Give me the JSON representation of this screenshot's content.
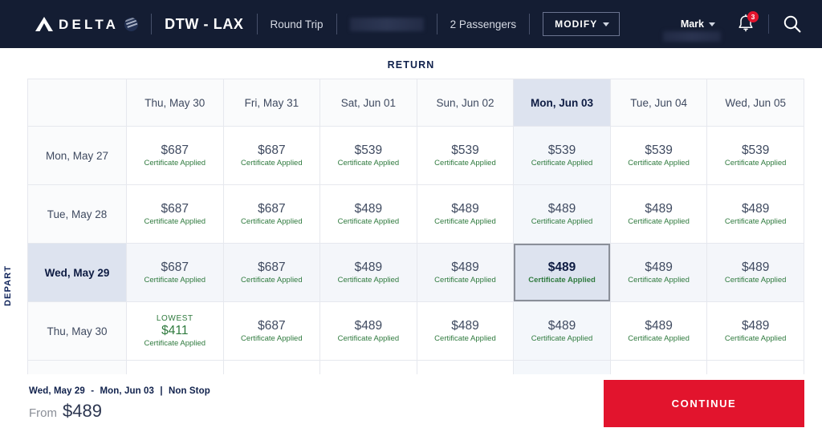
{
  "header": {
    "brand": "DELTA",
    "brand_icon": "delta-triangle-logo",
    "skymiles_icon": "skymiles-badge-icon",
    "route": "DTW - LAX",
    "trip_type": "Round Trip",
    "dates_redacted": "",
    "passengers": "2 Passengers",
    "modify_label": "MODIFY",
    "user_name": "Mark",
    "notification_count": "3",
    "bell_icon": "notification-bell-icon",
    "search_icon": "search-icon",
    "bg_color": "#141d33"
  },
  "matrix": {
    "return_heading": "RETURN",
    "depart_heading": "DEPART",
    "return_dates": [
      "Thu, May 30",
      "Fri, May 31",
      "Sat, Jun 01",
      "Sun, Jun 02",
      "Mon, Jun 03",
      "Tue, Jun 04",
      "Wed, Jun 05"
    ],
    "selected_return_index": 4,
    "selected_depart_index": 2,
    "cert_label": "Certificate Applied",
    "lowest_label": "LOWEST",
    "rows": [
      {
        "depart": "Mon, May 27",
        "prices": [
          "$687",
          "$687",
          "$539",
          "$539",
          "$539",
          "$539",
          "$539"
        ],
        "lowest": [
          false,
          false,
          false,
          false,
          false,
          false,
          false
        ]
      },
      {
        "depart": "Tue, May 28",
        "prices": [
          "$687",
          "$687",
          "$489",
          "$489",
          "$489",
          "$489",
          "$489"
        ],
        "lowest": [
          false,
          false,
          false,
          false,
          false,
          false,
          false
        ]
      },
      {
        "depart": "Wed, May 29",
        "prices": [
          "$687",
          "$687",
          "$489",
          "$489",
          "$489",
          "$489",
          "$489"
        ],
        "lowest": [
          false,
          false,
          false,
          false,
          false,
          false,
          false
        ]
      },
      {
        "depart": "Thu, May 30",
        "prices": [
          "$411",
          "$687",
          "$489",
          "$489",
          "$489",
          "$489",
          "$489"
        ],
        "lowest": [
          true,
          false,
          false,
          false,
          false,
          false,
          false
        ]
      }
    ],
    "accent_selected_bg": "#dde3ef",
    "cert_color": "#2f7a3e"
  },
  "footer": {
    "depart_date": "Wed, May 29",
    "dash": "-",
    "return_date": "Mon, Jun 03",
    "separator": "|",
    "stops": "Non Stop",
    "from_word": "From",
    "from_price": "$489",
    "continue_label": "CONTINUE",
    "continue_color": "#e2142d"
  }
}
